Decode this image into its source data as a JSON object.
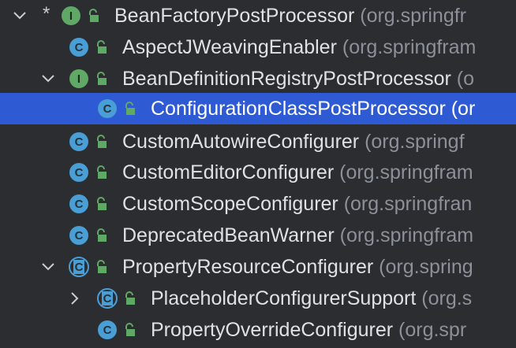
{
  "rows": [
    {
      "name": "BeanFactoryPostProcessor",
      "pkg": " (org.springfr",
      "icon": "interface",
      "marker": "*",
      "expander": "expanded"
    },
    {
      "name": "AspectJWeavingEnabler",
      "pkg": " (org.springfram",
      "icon": "class"
    },
    {
      "name": "BeanDefinitionRegistryPostProcessor",
      "pkg": " (o",
      "icon": "interface",
      "expander": "expanded"
    },
    {
      "name": "ConfigurationClassPostProcessor",
      "pkg": " (or",
      "icon": "class"
    },
    {
      "name": "CustomAutowireConfigurer",
      "pkg": " (org.springf",
      "icon": "class"
    },
    {
      "name": "CustomEditorConfigurer",
      "pkg": " (org.springfram",
      "icon": "class"
    },
    {
      "name": "CustomScopeConfigurer",
      "pkg": " (org.springfran",
      "icon": "class"
    },
    {
      "name": "DeprecatedBeanWarner",
      "pkg": " (org.springfram",
      "icon": "class"
    },
    {
      "name": "PropertyResourceConfigurer",
      "pkg": " (org.spring",
      "icon": "abstract-class",
      "expander": "expanded"
    },
    {
      "name": "PlaceholderConfigurerSupport",
      "pkg": " (org.s",
      "icon": "abstract-class",
      "expander": "collapsed"
    },
    {
      "name": "PropertyOverrideConfigurer",
      "pkg": " (org.spr",
      "icon": "class"
    }
  ],
  "icon_letters": {
    "class": "C",
    "interface": "I"
  },
  "colors": {
    "background": "#2b2d30",
    "selection": "#2e5bd3",
    "class_icon": "#4a9ed6",
    "interface_icon": "#5fa865",
    "package_text": "#8c9099"
  }
}
